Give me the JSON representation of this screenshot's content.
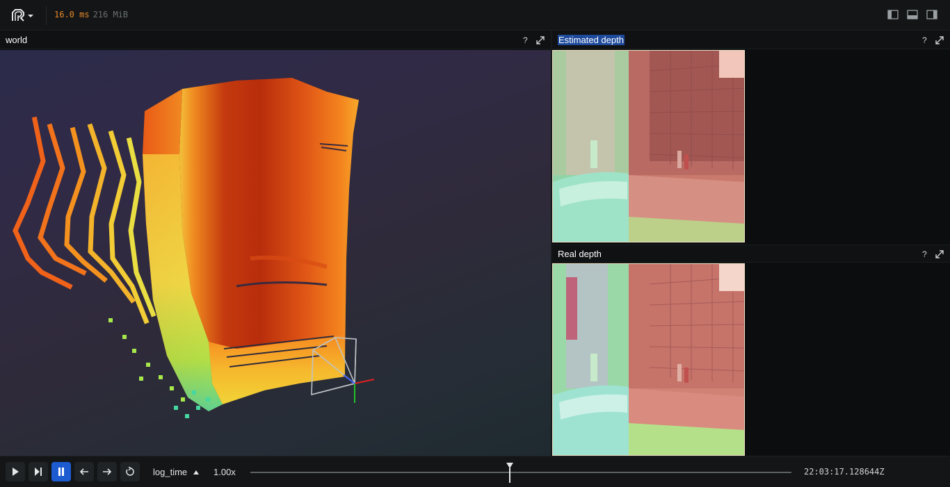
{
  "perf": {
    "frame_time": "16.0 ms",
    "memory": "216 MiB"
  },
  "panels": {
    "world": {
      "title": "world",
      "help": "?"
    },
    "estimated": {
      "title": "Estimated depth",
      "help": "?"
    },
    "real": {
      "title": "Real depth",
      "help": "?"
    }
  },
  "playback": {
    "timeline": "log_time",
    "speed": "1.00x",
    "time": "22:03:17.128644Z",
    "position": 0.48
  },
  "colors": {
    "accent": "#1d5bd1",
    "frame_time": "#e78a2a"
  },
  "icons": [
    "rerun-logo-icon",
    "chevron-down-icon",
    "layout-left-panel-icon",
    "layout-bottom-panel-icon",
    "layout-right-panel-icon",
    "help-icon",
    "maximize-icon",
    "play-icon",
    "step-forward-icon",
    "pause-icon",
    "arrow-left-icon",
    "arrow-right-icon",
    "loop-icon",
    "chevron-up-icon"
  ]
}
